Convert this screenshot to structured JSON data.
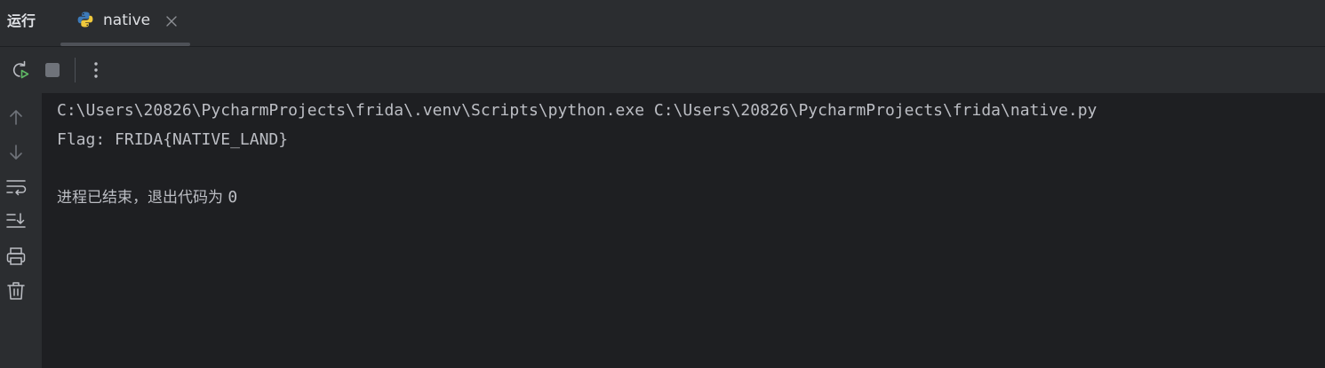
{
  "header": {
    "panel_title": "运行",
    "tabs": [
      {
        "label": "native",
        "icon": "python-icon"
      }
    ]
  },
  "toolbar": {
    "buttons": [
      "rerun-icon",
      "stop-icon",
      "more-options-icon"
    ]
  },
  "gutter": {
    "buttons": [
      "arrow-up-icon",
      "arrow-down-icon",
      "soft-wrap-icon",
      "scroll-to-end-icon",
      "print-icon",
      "trash-icon"
    ]
  },
  "console": {
    "command_line": "C:\\Users\\20826\\PycharmProjects\\frida\\.venv\\Scripts\\python.exe C:\\Users\\20826\\PycharmProjects\\frida\\native.py",
    "output_line": "Flag: FRIDA{NATIVE_LAND}",
    "exit_message": "进程已结束，退出代码为 ",
    "exit_code": "0"
  },
  "colors": {
    "background": "#1e1f22",
    "panel": "#2b2d30",
    "text": "#bcbec4",
    "rerun_green": "#5fb865"
  }
}
